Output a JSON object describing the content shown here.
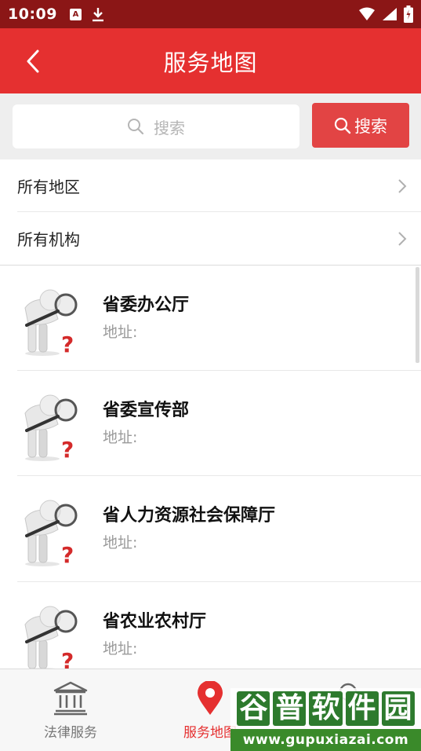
{
  "status_bar": {
    "time": "10:09",
    "a_icon_letter": "A"
  },
  "header": {
    "title": "服务地图"
  },
  "search": {
    "placeholder": "搜索",
    "button_label": "搜索"
  },
  "filters": [
    {
      "label": "所有地区"
    },
    {
      "label": "所有机构"
    }
  ],
  "list": [
    {
      "name": "省委办公厅",
      "address_label": "地址:"
    },
    {
      "name": "省委宣传部",
      "address_label": "地址:"
    },
    {
      "name": "省人力资源社会保障厅",
      "address_label": "地址:"
    },
    {
      "name": "省农业农村厅",
      "address_label": "地址:"
    }
  ],
  "bottom_nav": {
    "items": [
      {
        "label": "法律服务",
        "icon": "bank-icon",
        "active": false
      },
      {
        "label": "服务地图",
        "icon": "map-pin-icon",
        "active": true
      },
      {
        "label": "",
        "icon": "search-icon",
        "active": false
      }
    ]
  },
  "watermark": {
    "chars": [
      "谷",
      "普",
      "软",
      "件",
      "园"
    ],
    "url": "www.gupuxiazai.com"
  },
  "colors": {
    "accent": "#e53030",
    "status_bar": "#8b1616",
    "search_button": "#e24444",
    "active_nav": "#e53030",
    "inactive_nav": "#777777"
  }
}
